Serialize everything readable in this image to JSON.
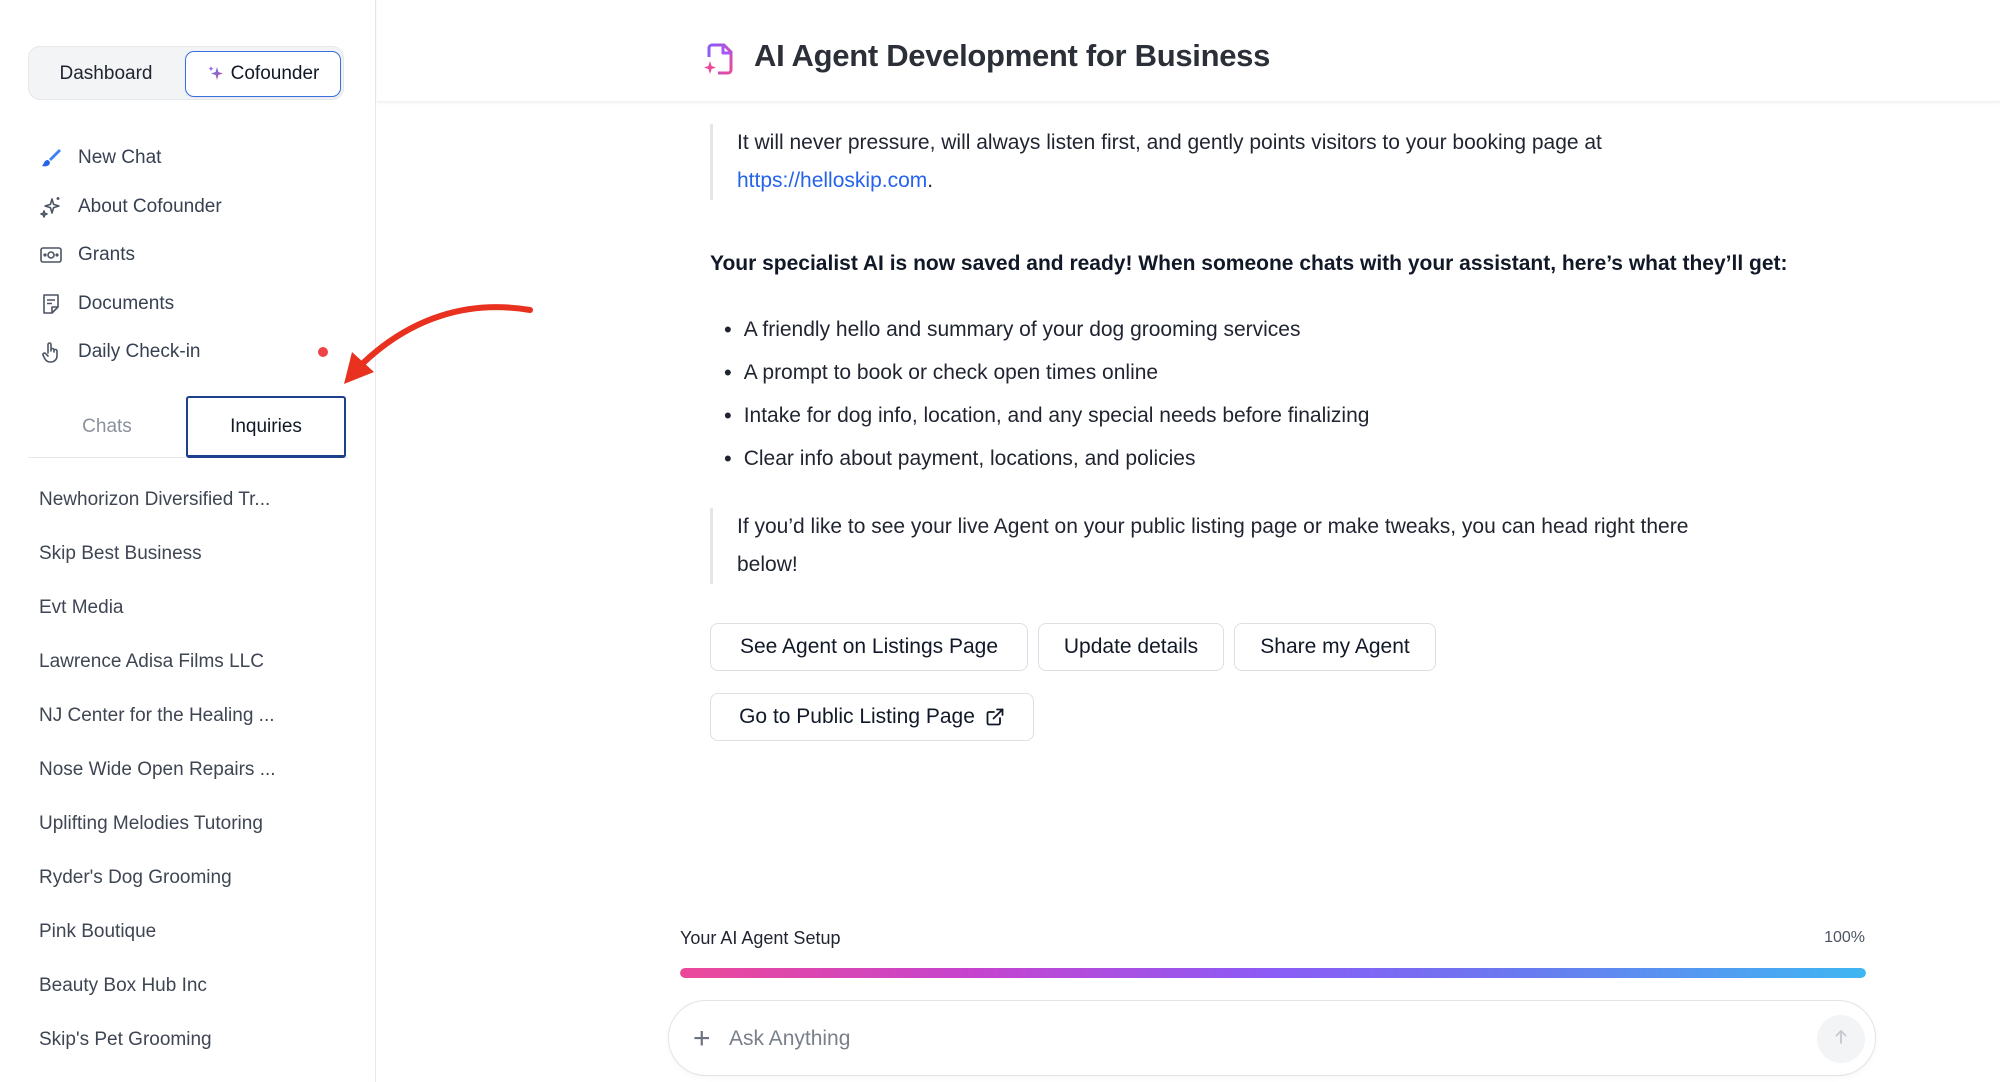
{
  "sidebar": {
    "mode_switch": {
      "dashboard": "Dashboard",
      "cofounder": "Cofounder"
    },
    "nav": [
      {
        "label": "New Chat",
        "icon": "brush-icon"
      },
      {
        "label": "About Cofounder",
        "icon": "sparkles-icon"
      },
      {
        "label": "Grants",
        "icon": "money-icon"
      },
      {
        "label": "Documents",
        "icon": "document-icon"
      },
      {
        "label": "Daily Check-in",
        "icon": "hand-pointer-icon",
        "notification_dot": true
      }
    ],
    "tabs": {
      "chats": "Chats",
      "inquiries": "Inquiries",
      "active": "inquiries"
    },
    "inquiries": [
      "Newhorizon Diversified Tr...",
      "Skip Best Business",
      "Evt Media",
      "Lawrence Adisa Films LLC",
      "NJ Center for the Healing ...",
      "Nose Wide Open Repairs ...",
      "Uplifting Melodies Tutoring",
      "Ryder's Dog Grooming",
      "Pink Boutique",
      "Beauty Box Hub Inc",
      "Skip's Pet Grooming"
    ]
  },
  "header": {
    "title": "AI Agent Development for Business"
  },
  "message": {
    "quote1_text": "It will never pressure, will always listen first, and gently points visitors to your booking page at",
    "quote1_link": "https://helloskip.com",
    "quote1_end": ".",
    "bold_line": "Your specialist AI is now saved and ready! When someone chats with your assistant, here’s what they’ll get:",
    "bullets": [
      "A friendly hello and summary of your dog grooming services",
      "A prompt to book or check open times online",
      "Intake for dog info, location, and any special needs before finalizing",
      "Clear info about payment, locations, and policies"
    ],
    "quote2_line1": "If you’d like to see your live Agent on your public listing page or make tweaks, you can head right there",
    "quote2_line2": "below!"
  },
  "actions": {
    "see_agent": "See Agent on Listings Page",
    "update_details": "Update details",
    "share_agent": "Share my Agent",
    "public_listing": "Go to Public Listing Page"
  },
  "setup": {
    "label": "Your AI Agent Setup",
    "percent_text": "100%",
    "progress": 1.0
  },
  "composer": {
    "placeholder": "Ask Anything"
  },
  "colors": {
    "accent": "#2563eb",
    "active_tab_border": "#1d3f8c",
    "notification": "#ef4444",
    "annotation_arrow": "#e8321f"
  }
}
